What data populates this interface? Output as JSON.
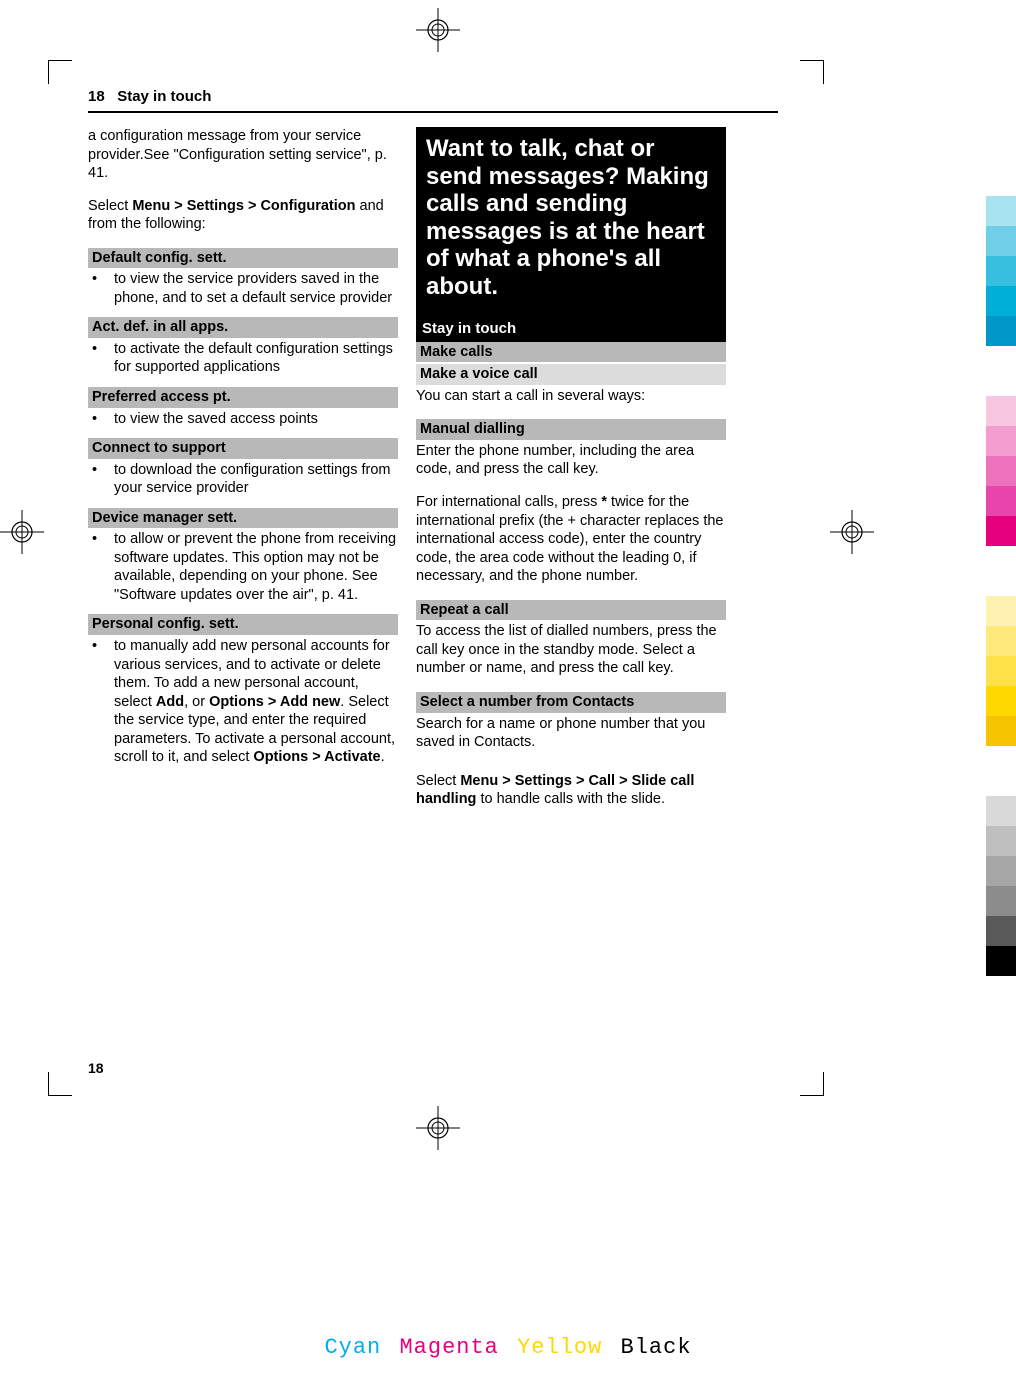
{
  "header": {
    "page_num_top": "18",
    "section": "Stay in touch"
  },
  "footer_page_num": "18",
  "left": {
    "intro": "a configuration message from your service provider.See \"Configuration setting service\", p. 41.",
    "select_line_pre": "Select ",
    "select_path": "Menu  > Settings  > Configuration",
    "select_line_post": " and from the following:",
    "blocks": [
      {
        "head": "Default config. sett.",
        "text": "to view the service providers saved in the phone, and to set a default service provider"
      },
      {
        "head": "Act. def. in all apps.",
        "text": "to activate the default configuration settings for supported applications"
      },
      {
        "head": "Preferred access pt.",
        "text": "to view the saved access points"
      },
      {
        "head": "Connect to support",
        "text": "to download the configuration settings from your service provider"
      },
      {
        "head": "Device manager sett.",
        "text": "to allow or prevent the phone from receiving software updates. This option may not be available, depending on your phone. See \"Software updates over the air\", p. 41."
      }
    ],
    "personal": {
      "head": "Personal config. sett.",
      "t1": "to manually add new personal accounts for various services, and to activate or delete them. To add a new personal account, select ",
      "add": "Add",
      "t2": ", or ",
      "opt_add": "Options  > Add new",
      "t3": ". Select the service type, and enter the required parameters. To activate a personal account, scroll to it, and select ",
      "opt_act": "Options  > Activate",
      "t4": "."
    }
  },
  "right": {
    "chapter": "Want to talk, chat or send messages? Making calls and sending messages is at the heart of what a phone's all about.",
    "section_band": "Stay in touch",
    "make_calls": "Make calls",
    "make_voice": "Make a voice call",
    "voice_intro": "You can start a call in several ways:",
    "manual_head": "Manual dialling",
    "manual_p1": "Enter the phone number, including the area code, and press the call key.",
    "manual_p2a": "For international calls, press ",
    "manual_star": "*",
    "manual_p2b": " twice for the international prefix (the + character replaces the international access code), enter the country code, the area code without the leading 0, if necessary, and the phone number.",
    "repeat_head": "Repeat a call",
    "repeat_text": "To access the list of dialled numbers, press the call key once in the standby mode. Select a number or name, and press the call key.",
    "contacts_head": "Select a number from Contacts",
    "contacts_text": "Search for a name or phone number that you saved in Contacts.",
    "slide_pre": "Select ",
    "slide_path": "Menu  > Settings  > Call  > Slide call handling",
    "slide_post": " to handle calls with the slide."
  },
  "cmyk": {
    "c": "Cyan",
    "m": "Magenta",
    "y": "Yellow",
    "k": "Black"
  },
  "swatches_top": [
    "#a8e3f0",
    "#6fcfe8",
    "#37bfe0",
    "#00afd7",
    "#0096c7"
  ],
  "swatches_mid": [
    "#f7c6e0",
    "#f29ccf",
    "#ed72be",
    "#e945ad",
    "#e6007e"
  ],
  "swatches_low": [
    "#fff2b0",
    "#ffe97a",
    "#ffe24a",
    "#ffd800",
    "#f5c400"
  ],
  "swatches_grey": [
    "#d9d9d9",
    "#bfbfbf",
    "#a6a6a6",
    "#8c8c8c",
    "#595959",
    "#000000"
  ]
}
